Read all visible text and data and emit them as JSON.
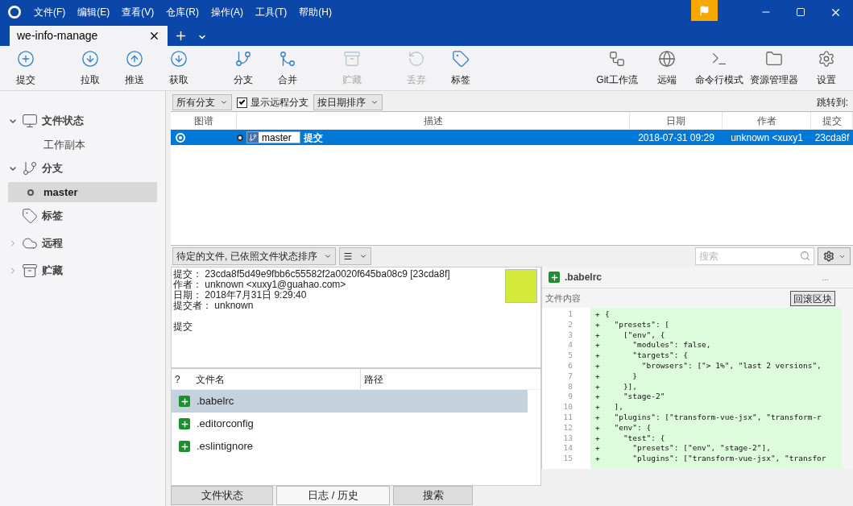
{
  "menu": [
    "文件(F)",
    "编辑(E)",
    "查看(V)",
    "仓库(R)",
    "操作(A)",
    "工具(T)",
    "帮助(H)"
  ],
  "tabs": [
    {
      "label": "we-info-manage",
      "selected": true
    }
  ],
  "toolbar_left": [
    {
      "label": "提交",
      "disabled": false
    },
    {
      "label": "拉取",
      "disabled": false
    },
    {
      "label": "推送",
      "disabled": false
    },
    {
      "label": "获取",
      "disabled": false
    },
    {
      "label": "分支",
      "disabled": false
    },
    {
      "label": "合并",
      "disabled": false
    },
    {
      "label": "贮藏",
      "disabled": true
    },
    {
      "label": "丢弃",
      "disabled": true
    },
    {
      "label": "标签",
      "disabled": false
    }
  ],
  "toolbar_right": [
    {
      "label": "Git工作流"
    },
    {
      "label": "远端"
    },
    {
      "label": "命令行模式"
    },
    {
      "label": "资源管理器"
    },
    {
      "label": "设置"
    }
  ],
  "sidebar": [
    {
      "label": "文件状态",
      "kind": "group",
      "expanded": true,
      "children": [
        {
          "label": "工作副本",
          "selected": false
        }
      ]
    },
    {
      "label": "分支",
      "kind": "group",
      "expanded": true,
      "children": [
        {
          "label": "master",
          "selected": true
        }
      ]
    },
    {
      "label": "标签",
      "kind": "leaf"
    },
    {
      "label": "远程",
      "kind": "group",
      "expanded": false
    },
    {
      "label": "贮藏",
      "kind": "group",
      "expanded": false
    }
  ],
  "filter_bar": {
    "branches": "所有分支",
    "show_remote": {
      "label": "显示远程分支",
      "checked": true
    },
    "sort": "按日期排序",
    "jump_to": "跳转到:"
  },
  "commits": {
    "columns": [
      "图谱",
      "描述",
      "日期",
      "作者",
      "提交"
    ],
    "rows": [
      {
        "branch": "master",
        "description": "提交",
        "date": "2018-07-31 09:29",
        "author": "unknown <xuxy1",
        "hash": "23cda8f",
        "selected": true
      }
    ]
  },
  "pending_bar": {
    "sort": "待定的文件, 已依照文件状态排序",
    "search_placeholder": "搜索"
  },
  "details": {
    "fields": [
      {
        "label": "提交：",
        "value": "23cda8f5d49e9fbb6c55582f2a0020f645ba08c9 [23cda8f]"
      },
      {
        "label": "作者：",
        "value": "unknown <xuxy1@guahao.com>"
      },
      {
        "label": "日期：",
        "value": "2018年7月31日 9:29:40"
      },
      {
        "label": "提交者：",
        "value": "unknown"
      }
    ],
    "message": "提交"
  },
  "files": {
    "columns": [
      "?",
      "文件名",
      "路径"
    ],
    "rows": [
      {
        "name": ".babelrc",
        "selected": true
      },
      {
        "name": ".editorconfig",
        "selected": false
      },
      {
        "name": ".eslintignore",
        "selected": false
      }
    ]
  },
  "bottom_tabs": [
    {
      "label": "文件状态",
      "selected": false
    },
    {
      "label": "日志 / 历史",
      "selected": true
    },
    {
      "label": "搜索",
      "selected": false
    }
  ],
  "diff": {
    "file": ".babelrc",
    "more": "...",
    "section": "文件内容",
    "button": "回滚区块",
    "lines": [
      {
        "num": "1",
        "sign": "+",
        "text": "{"
      },
      {
        "num": "2",
        "sign": "+",
        "text": "  \"presets\": ["
      },
      {
        "num": "3",
        "sign": "+",
        "text": "    [\"env\", {"
      },
      {
        "num": "4",
        "sign": "+",
        "text": "      \"modules\": false,"
      },
      {
        "num": "5",
        "sign": "+",
        "text": "      \"targets\": {"
      },
      {
        "num": "6",
        "sign": "+",
        "text": "        \"browsers\": [\"> 1%\", \"last 2 versions\","
      },
      {
        "num": "7",
        "sign": "+",
        "text": "      }"
      },
      {
        "num": "8",
        "sign": "+",
        "text": "    }],"
      },
      {
        "num": "9",
        "sign": "+",
        "text": "    \"stage-2\""
      },
      {
        "num": "10",
        "sign": "+",
        "text": "  ],"
      },
      {
        "num": "11",
        "sign": "+",
        "text": "  \"plugins\": [\"transform-vue-jsx\", \"transform-r"
      },
      {
        "num": "12",
        "sign": "+",
        "text": "  \"env\": {"
      },
      {
        "num": "13",
        "sign": "+",
        "text": "    \"test\": {"
      },
      {
        "num": "14",
        "sign": "+",
        "text": "      \"presets\": [\"env\", \"stage-2\"],"
      },
      {
        "num": "15",
        "sign": "+",
        "text": "      \"plugins\": [\"transform-vue-jsx\", \"transfor"
      }
    ]
  }
}
